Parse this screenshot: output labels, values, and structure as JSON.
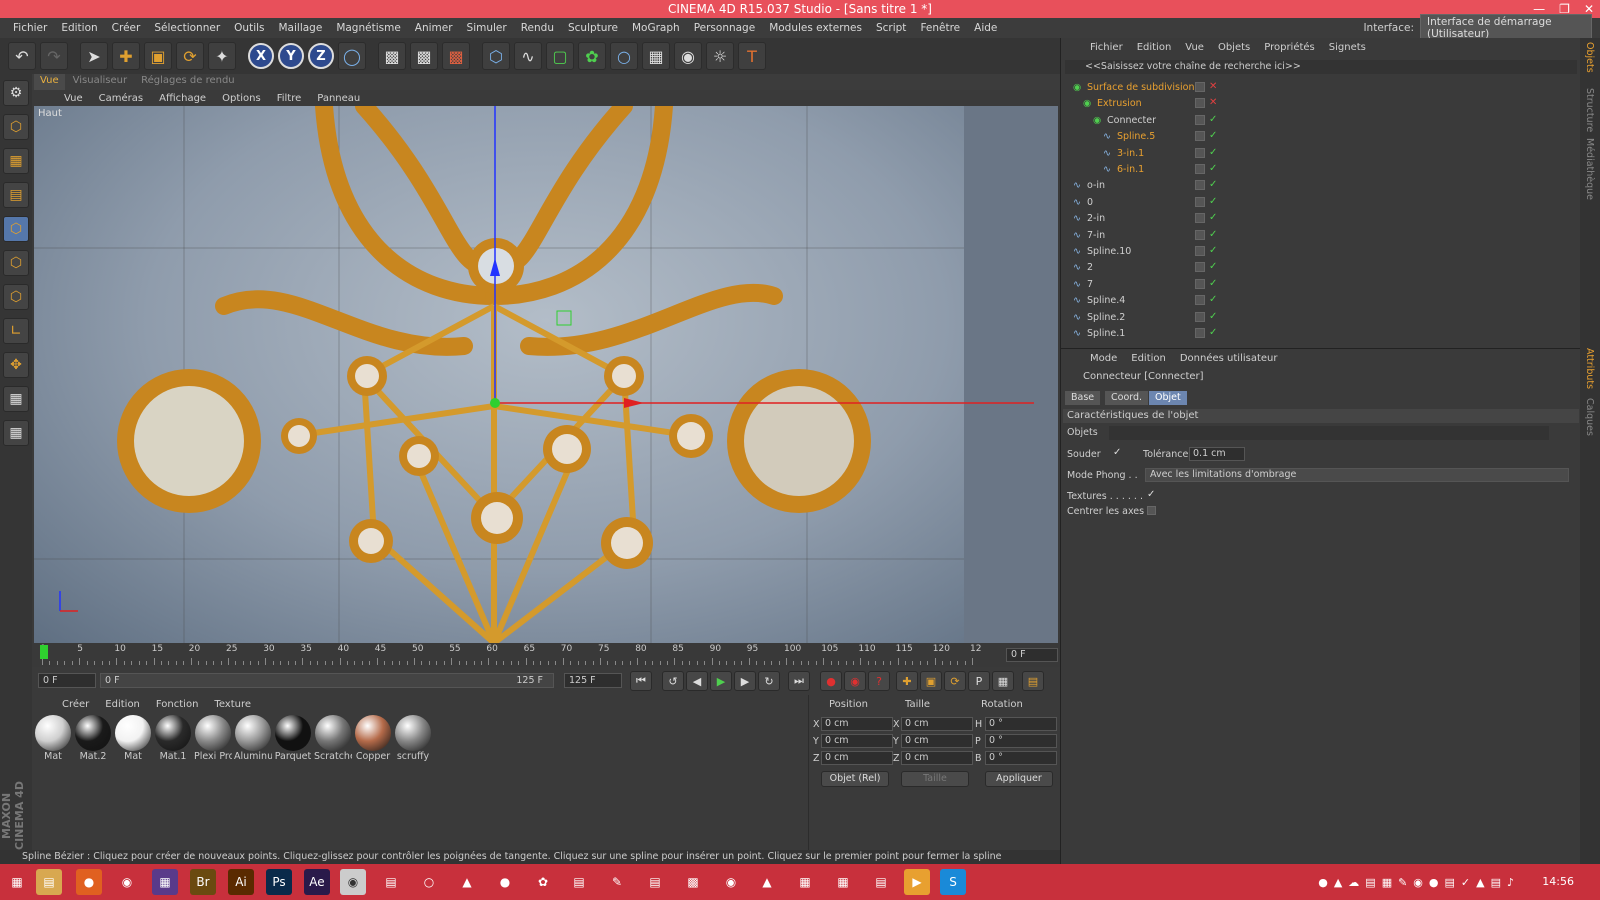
{
  "window": {
    "title": "CINEMA 4D R15.037 Studio - [Sans titre 1 *]"
  },
  "menu": [
    "Fichier",
    "Edition",
    "Créer",
    "Sélectionner",
    "Outils",
    "Maillage",
    "Magnétisme",
    "Animer",
    "Simuler",
    "Rendu",
    "Sculpture",
    "MoGraph",
    "Personnage",
    "Modules externes",
    "Script",
    "Fenêtre",
    "Aide"
  ],
  "interface": {
    "label": "Interface:",
    "value": "Interface de démarrage (Utilisateur)"
  },
  "view_tabs": [
    "Vue",
    "Visualiseur",
    "Réglages de rendu"
  ],
  "view_menu": [
    "Vue",
    "Caméras",
    "Affichage",
    "Options",
    "Filtre",
    "Panneau"
  ],
  "viewport": {
    "label": "Haut"
  },
  "timeline": {
    "ticks": [
      "0",
      "5",
      "10",
      "15",
      "20",
      "25",
      "30",
      "35",
      "40",
      "45",
      "50",
      "55",
      "60",
      "65",
      "70",
      "75",
      "80",
      "85",
      "90",
      "95",
      "100",
      "105",
      "110",
      "115",
      "120",
      "12"
    ],
    "frame_right": "0 F"
  },
  "transport": {
    "start": "0 F",
    "range_start": "0 F",
    "range_end": "125 F",
    "end": "125 F"
  },
  "material_menu": [
    "Créer",
    "Edition",
    "Fonction",
    "Texture"
  ],
  "materials": [
    {
      "name": "Mat",
      "color": "#cfcfcf"
    },
    {
      "name": "Mat.2",
      "color": "#1a1a1a"
    },
    {
      "name": "Mat",
      "color": "#f2f2f2"
    },
    {
      "name": "Mat.1",
      "color": "#2a2a2a"
    },
    {
      "name": "Plexi Pro",
      "color": "#8a8a8a"
    },
    {
      "name": "Aluminu",
      "color": "#9a9a9a"
    },
    {
      "name": "Parquet",
      "color": "#111111"
    },
    {
      "name": "Scratche",
      "color": "#777777"
    },
    {
      "name": "Copper",
      "color": "#b56b4a"
    },
    {
      "name": "scruffy",
      "color": "#888888"
    }
  ],
  "coords": {
    "headers": [
      "Position",
      "Taille",
      "Rotation"
    ],
    "rows": [
      {
        "axis": "X",
        "pos": "0 cm",
        "size_axis": "X",
        "size": "0 cm",
        "rot_axis": "H",
        "rot": "0 °"
      },
      {
        "axis": "Y",
        "pos": "0 cm",
        "size_axis": "Y",
        "size": "0 cm",
        "rot_axis": "P",
        "rot": "0 °"
      },
      {
        "axis": "Z",
        "pos": "0 cm",
        "size_axis": "Z",
        "size": "0 cm",
        "rot_axis": "B",
        "rot": "0 °"
      }
    ],
    "mode": "Objet (Rel)",
    "size_mode": "Taille",
    "apply": "Appliquer"
  },
  "status": "Spline Bézier : Cliquez pour créer de nouveaux points. Cliquez-glissez pour contrôler les poignées de tangente. Cliquez sur une spline pour insérer un point. Cliquez sur le premier point pour fermer la spline",
  "object_manager": {
    "menu": [
      "Fichier",
      "Edition",
      "Vue",
      "Objets",
      "Propriétés",
      "Signets"
    ],
    "search": "<<Saisissez votre chaîne de recherche ici>>",
    "objects": [
      {
        "name": "Surface de subdivision",
        "indent": 0,
        "orange": true,
        "x": true
      },
      {
        "name": "Extrusion",
        "indent": 1,
        "orange": true,
        "x": true
      },
      {
        "name": "Connecter",
        "indent": 2,
        "orange": false,
        "x": false
      },
      {
        "name": "Spline.5",
        "indent": 3,
        "orange": true,
        "x": false
      },
      {
        "name": "3-in.1",
        "indent": 3,
        "orange": true,
        "x": false
      },
      {
        "name": "6-in.1",
        "indent": 3,
        "orange": true,
        "x": false
      },
      {
        "name": "o-in",
        "indent": 0,
        "orange": false,
        "x": false
      },
      {
        "name": "0",
        "indent": 0,
        "orange": false,
        "x": false
      },
      {
        "name": "2-in",
        "indent": 0,
        "orange": false,
        "x": false
      },
      {
        "name": "7-in",
        "indent": 0,
        "orange": false,
        "x": false
      },
      {
        "name": "Spline.10",
        "indent": 0,
        "orange": false,
        "x": false
      },
      {
        "name": "2",
        "indent": 0,
        "orange": false,
        "x": false
      },
      {
        "name": "7",
        "indent": 0,
        "orange": false,
        "x": false
      },
      {
        "name": "Spline.4",
        "indent": 0,
        "orange": false,
        "x": false
      },
      {
        "name": "Spline.2",
        "indent": 0,
        "orange": false,
        "x": false
      },
      {
        "name": "Spline.1",
        "indent": 0,
        "orange": false,
        "x": false
      }
    ]
  },
  "attributes": {
    "menu": [
      "Mode",
      "Edition",
      "Données utilisateur"
    ],
    "object_title": "Connecteur [Connecter]",
    "tabs": [
      "Base",
      "Coord.",
      "Objet"
    ],
    "section": "Caractéristiques de l'objet",
    "objets_label": "Objets",
    "souder_label": "Souder",
    "tolerance_label": "Tolérance",
    "tolerance_value": "0.1 cm",
    "phong_label": "Mode Phong . .",
    "phong_value": "Avec les limitations d'ombrage",
    "textures_label": "Textures . . . . . .",
    "center_label": "Centrer les axes"
  },
  "right_strip": [
    "Objets",
    "Structure",
    "Médiathèque",
    "Attributs",
    "Calques"
  ],
  "taskbar": {
    "time": "14:56"
  },
  "accent": {
    "title_red": "#e8505b",
    "taskbar_red": "#c8303c",
    "orange": "#e8a030"
  }
}
